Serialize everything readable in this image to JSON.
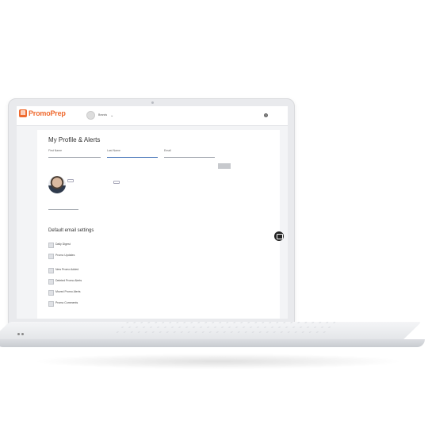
{
  "header": {
    "logo_text": "PromoPrep",
    "logo_tagline": "",
    "account_name": "Brands",
    "account_sub": "",
    "help_icon": "help-icon",
    "user_menu": ""
  },
  "profile": {
    "title": "My Profile & Alerts",
    "first_name_label": "First Name",
    "first_name_value": "",
    "last_name_label": "Last Name",
    "last_name_value": "",
    "email_label": "Email",
    "email_value": "",
    "update_button": "",
    "upload_button": "",
    "remove_photo": "",
    "reset_password_button": "",
    "phone_label": "",
    "phone_value": ""
  },
  "email_settings": {
    "title": "Default email settings",
    "subtitle": "",
    "options": [
      {
        "title": "Daily Digest",
        "desc": ""
      },
      {
        "title": "Promo Updates",
        "desc": ""
      },
      {
        "title": "New Promo Added",
        "desc": ""
      },
      {
        "title": "Deleted Promo Alerts",
        "desc": ""
      },
      {
        "title": "Moved Promo Alerts",
        "desc": ""
      },
      {
        "title": "Promo Comments",
        "desc": ""
      }
    ]
  }
}
